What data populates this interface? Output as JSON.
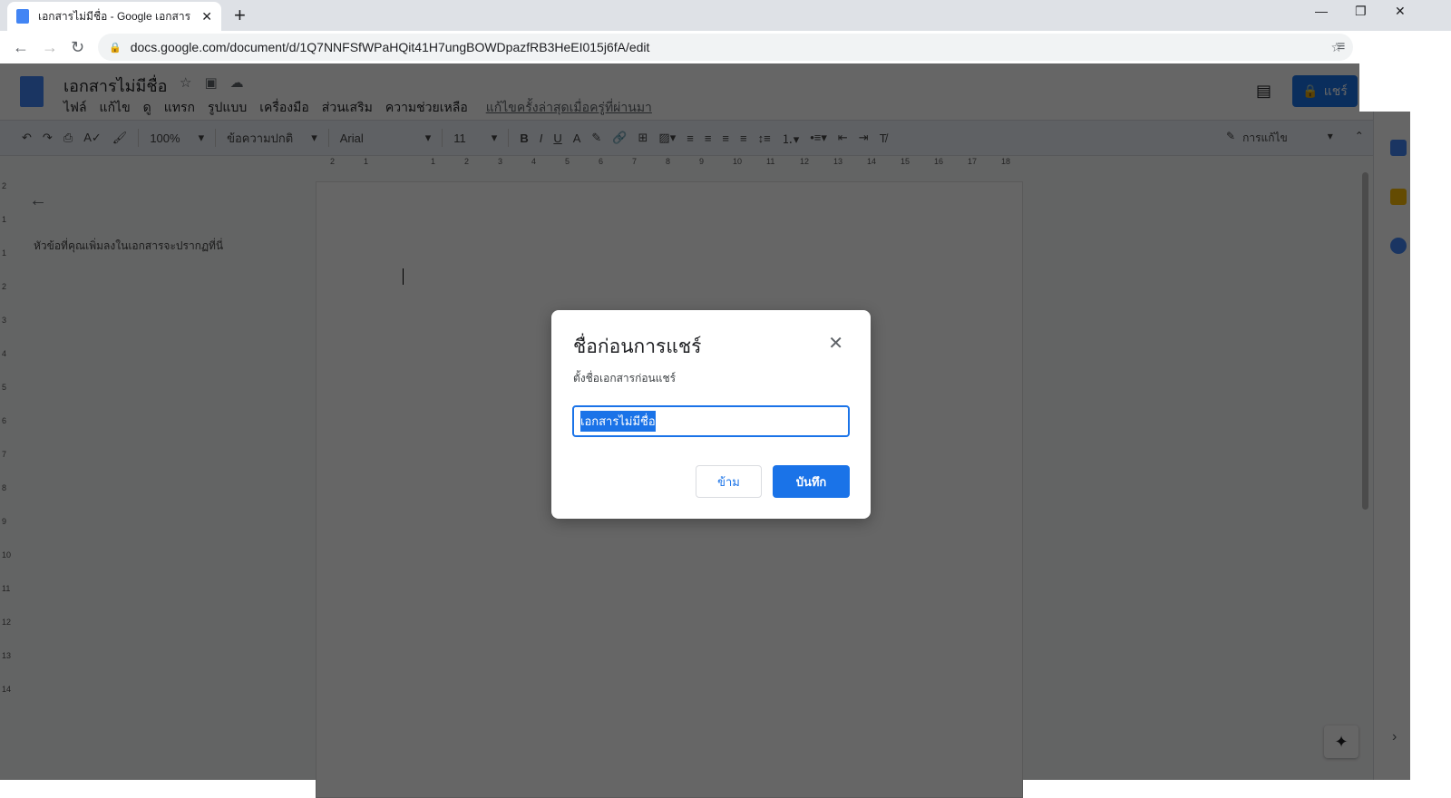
{
  "browser": {
    "tab_title": "เอกสารไม่มีชื่อ - Google เอกสาร",
    "url": "docs.google.com/document/d/1Q7NNFSfWPaHQit41H7ungBOWDpazfRB3HeEI015j6fA/edit"
  },
  "doc": {
    "title": "เอกสารไม่มีชื่อ",
    "menus": [
      "ไฟล์",
      "แก้ไข",
      "ดู",
      "แทรก",
      "รูปแบบ",
      "เครื่องมือ",
      "ส่วนเสริม",
      "ความช่วยเหลือ"
    ],
    "last_edit": "แก้ไขครั้งล่าสุดเมื่อครู่ที่ผ่านมา",
    "share_label": "แชร์"
  },
  "toolbar": {
    "zoom": "100%",
    "style": "ข้อความปกติ",
    "font": "Arial",
    "size": "11",
    "mode": "การแก้ไข"
  },
  "ruler": {
    "h": [
      "2",
      "1",
      "",
      "1",
      "2",
      "3",
      "4",
      "5",
      "6",
      "7",
      "8",
      "9",
      "10",
      "11",
      "12",
      "13",
      "14",
      "15",
      "16",
      "17",
      "18"
    ],
    "v": [
      "2",
      "1",
      "1",
      "2",
      "3",
      "4",
      "5",
      "6",
      "7",
      "8",
      "9",
      "10",
      "11",
      "12",
      "13",
      "14"
    ]
  },
  "outline": {
    "placeholder": "หัวข้อที่คุณเพิ่มลงในเอกสารจะปรากฏที่นี่"
  },
  "dialog": {
    "title": "ชื่อก่อนการแชร์",
    "subtitle": "ตั้งชื่อเอกสารก่อนแชร์",
    "input_value": "เอกสารไม่มีชื่อ",
    "skip": "ข้าม",
    "save": "บันทึก"
  },
  "colors": {
    "accent": "#1a73e8"
  }
}
